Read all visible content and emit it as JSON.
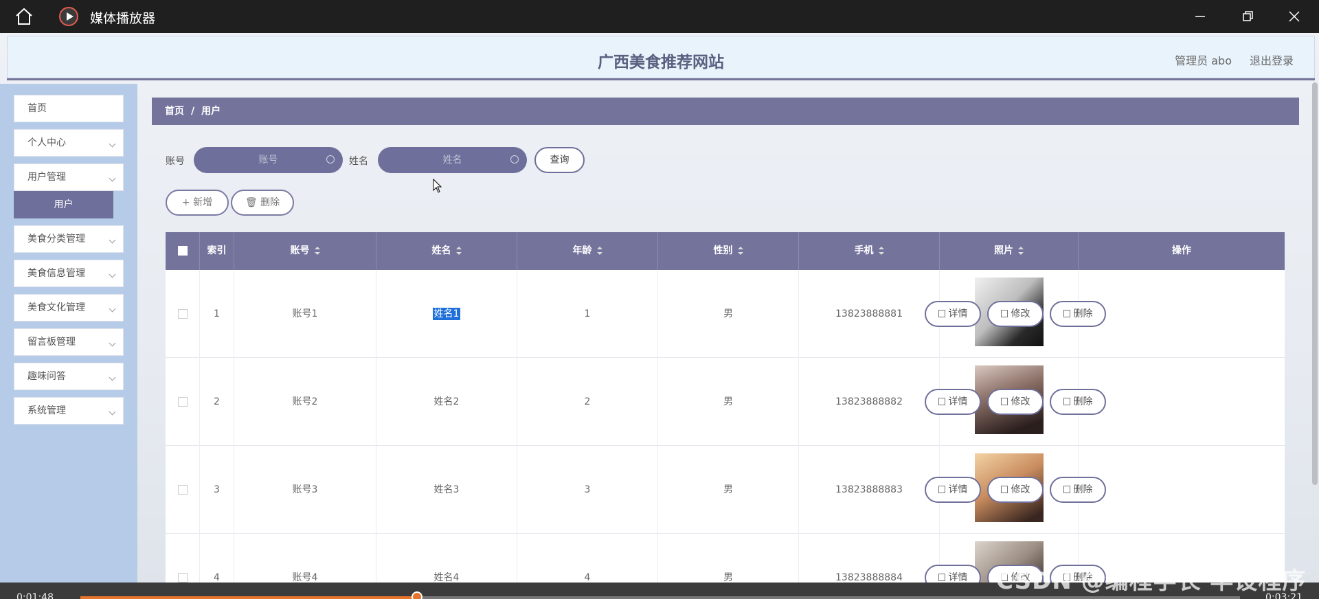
{
  "window": {
    "app_title": "媒体播放器"
  },
  "header": {
    "site_title": "广西美食推荐网站",
    "admin_label": "管理员 abo",
    "logout_label": "退出登录"
  },
  "sidebar": {
    "items": [
      {
        "label": "首页",
        "has_chevron": false
      },
      {
        "label": "个人中心",
        "has_chevron": true
      },
      {
        "label": "用户管理",
        "has_chevron": true
      },
      {
        "label": "美食分类管理",
        "has_chevron": true
      },
      {
        "label": "美食信息管理",
        "has_chevron": true
      },
      {
        "label": "美食文化管理",
        "has_chevron": true
      },
      {
        "label": "留言板管理",
        "has_chevron": true
      },
      {
        "label": "趣味问答",
        "has_chevron": true
      },
      {
        "label": "系统管理",
        "has_chevron": true
      }
    ],
    "active_sub": "用户"
  },
  "breadcrumb": {
    "home": "首页",
    "sep": "/",
    "current": "用户"
  },
  "search": {
    "account_label": "账号",
    "account_placeholder": "账号",
    "name_label": "姓名",
    "name_placeholder": "姓名",
    "query_button": "查询"
  },
  "actions": {
    "add_label": "新增",
    "delete_label": "删除"
  },
  "table": {
    "headers": [
      "索引",
      "账号",
      "姓名",
      "年龄",
      "性别",
      "手机",
      "照片",
      "操作"
    ],
    "rows": [
      {
        "index": "1",
        "account": "账号1",
        "name": "姓名1",
        "age": "1",
        "gender": "男",
        "phone": "13823888881",
        "selected_text": true
      },
      {
        "index": "2",
        "account": "账号2",
        "name": "姓名2",
        "age": "2",
        "gender": "男",
        "phone": "13823888882",
        "selected_text": false
      },
      {
        "index": "3",
        "account": "账号3",
        "name": "姓名3",
        "age": "3",
        "gender": "男",
        "phone": "13823888883",
        "selected_text": false
      },
      {
        "index": "4",
        "account": "账号4",
        "name": "姓名4",
        "age": "4",
        "gender": "男",
        "phone": "13823888884",
        "selected_text": false
      }
    ],
    "row_actions": {
      "detail": "详情",
      "edit": "修改",
      "delete": "删除"
    }
  },
  "player": {
    "current_time": "0:01:48",
    "total_time": "0:03:21",
    "progress_percent": 29
  },
  "watermark": "CSDN @编程学长 毕设程序",
  "colors": {
    "accent": "#74739c",
    "progress": "#e7742d",
    "selection": "#1e6fd9"
  }
}
